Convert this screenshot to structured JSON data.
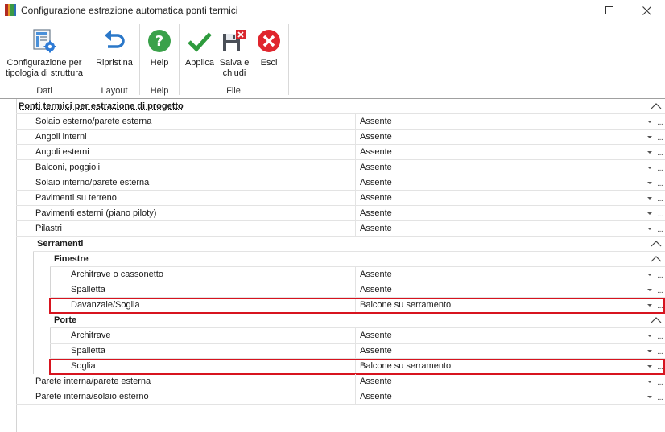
{
  "window": {
    "title": "Configurazione estrazione automatica ponti termici",
    "app_icon_colors": [
      "#c0392b",
      "#e67e22",
      "#27ae60",
      "#2980b9",
      "#8e44ad"
    ]
  },
  "ribbon": {
    "buttons": {
      "config": {
        "label": "Configurazione per\ntipologia di struttura",
        "icon": "structure-config-icon"
      },
      "ripristina": {
        "label": "Ripristina",
        "icon": "undo-icon"
      },
      "help": {
        "label": "Help",
        "icon": "help-icon"
      },
      "applica": {
        "label": "Applica",
        "icon": "check-icon"
      },
      "salva": {
        "label": "Salva e\nchiudi",
        "icon": "save-close-icon"
      },
      "esci": {
        "label": "Esci",
        "icon": "exit-icon"
      }
    },
    "groups": {
      "dati": "Dati",
      "layout": "Layout",
      "help": "Help",
      "file": "File"
    }
  },
  "grid": {
    "root_category": "Ponti termici per estrazione di progetto",
    "rows_top": [
      {
        "name": "Solaio esterno/parete esterna",
        "value": "Assente"
      },
      {
        "name": "Angoli interni",
        "value": "Assente"
      },
      {
        "name": "Angoli esterni",
        "value": "Assente"
      },
      {
        "name": "Balconi, poggioli",
        "value": "Assente"
      },
      {
        "name": "Solaio interno/parete esterna",
        "value": "Assente"
      },
      {
        "name": "Pavimenti su terreno",
        "value": "Assente"
      },
      {
        "name": "Pavimenti esterni (piano piloty)",
        "value": "Assente"
      },
      {
        "name": "Pilastri",
        "value": "Assente"
      }
    ],
    "serramenti_category": "Serramenti",
    "finestre_category": "Finestre",
    "finestre_rows": [
      {
        "name": "Architrave o cassonetto",
        "value": "Assente"
      },
      {
        "name": "Spalletta",
        "value": "Assente"
      },
      {
        "name": "Davanzale/Soglia",
        "value": "Balcone su serramento"
      }
    ],
    "porte_category": "Porte",
    "porte_rows": [
      {
        "name": "Architrave",
        "value": "Assente"
      },
      {
        "name": "Spalletta",
        "value": "Assente"
      },
      {
        "name": "Soglia",
        "value": "Balcone su serramento"
      }
    ],
    "rows_bottom": [
      {
        "name": "Parete interna/parete esterna",
        "value": "Assente"
      },
      {
        "name": "Parete interna/solaio esterno",
        "value": "Assente"
      }
    ],
    "ellipsis": "···",
    "highlight_color": "#d7141f"
  }
}
